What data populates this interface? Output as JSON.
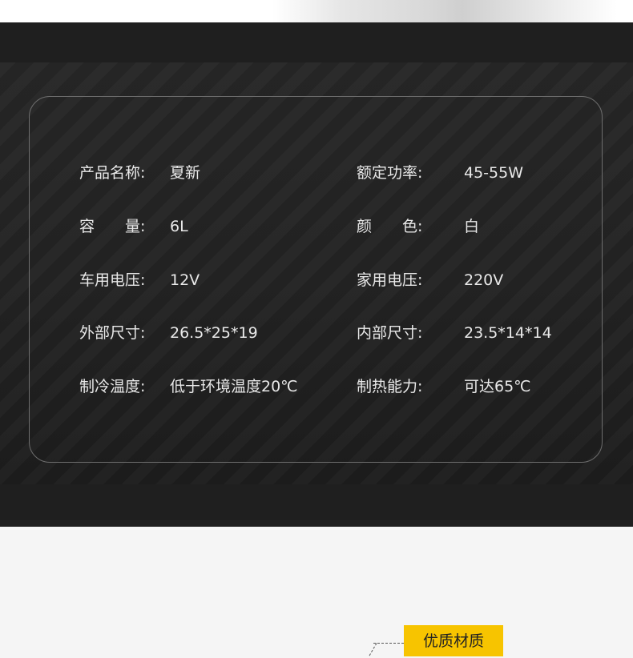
{
  "specs": [
    {
      "label": "产品名称:",
      "value": "夏新",
      "label2": "额定功率:",
      "value2": "45-55W"
    },
    {
      "label": "容　　量:",
      "value": "6L",
      "label2": "颜　　色:",
      "value2": "白"
    },
    {
      "label": "车用电压:",
      "value": "12V",
      "label2": "家用电压:",
      "value2": " 220V"
    },
    {
      "label": "外部尺寸:",
      "value": "26.5*25*19",
      "label2": "内部尺寸:",
      "value2": "23.5*14*14"
    },
    {
      "label": "制冷温度:",
      "value": "低于环境温度20℃",
      "label2": "制热能力:",
      "value2": "可达65℃"
    }
  ],
  "feature_tag": {
    "label": "优质材质",
    "color": "#f7c400"
  },
  "colors": {
    "panel": "#1f1f1f",
    "card_border": "#6e6e6e",
    "text": "#e9e9e9"
  }
}
